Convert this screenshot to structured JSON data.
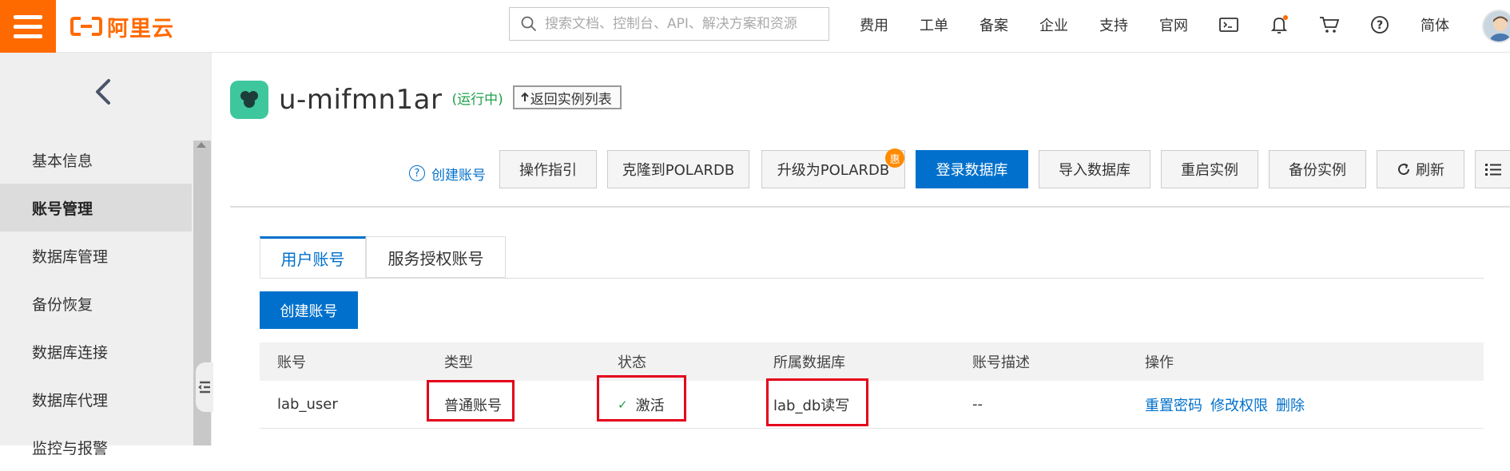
{
  "brand": {
    "logo_text": "阿里云",
    "accent": "#ff6a00"
  },
  "search": {
    "placeholder": "搜索文档、控制台、API、解决方案和资源"
  },
  "topnav": {
    "items": [
      "费用",
      "工单",
      "备案",
      "企业",
      "支持",
      "官网"
    ],
    "lang": "简体",
    "icons": [
      "terminal-icon",
      "bell-icon",
      "cart-icon",
      "help-icon"
    ]
  },
  "sidebar": {
    "items": [
      {
        "label": "基本信息",
        "active": false
      },
      {
        "label": "账号管理",
        "active": true
      },
      {
        "label": "数据库管理",
        "active": false
      },
      {
        "label": "备份恢复",
        "active": false
      },
      {
        "label": "数据库连接",
        "active": false
      },
      {
        "label": "数据库代理",
        "active": false
      },
      {
        "label": "监控与报警",
        "active": false
      }
    ]
  },
  "instance": {
    "name": "u-mifmn1ar",
    "status": "(运行中)",
    "back_label": "返回实例列表"
  },
  "toolbar": {
    "help_link": "创建账号",
    "buttons": [
      "操作指引",
      "克隆到POLARDB",
      "升级为POLARDB",
      "登录数据库",
      "导入数据库",
      "重启实例",
      "备份实例",
      "刷新"
    ],
    "promo_badge": "惠",
    "primary_color": "#0070cc"
  },
  "tabs": [
    "用户账号",
    "服务授权账号"
  ],
  "create_button": "创建账号",
  "table": {
    "columns": [
      "账号",
      "类型",
      "状态",
      "所属数据库",
      "账号描述",
      "操作"
    ],
    "rows": [
      {
        "account": "lab_user",
        "type": "普通账号",
        "status": "激活",
        "database": "lab_db读写",
        "description": "--",
        "actions": [
          "重置密码",
          "修改权限",
          "删除"
        ]
      }
    ]
  }
}
